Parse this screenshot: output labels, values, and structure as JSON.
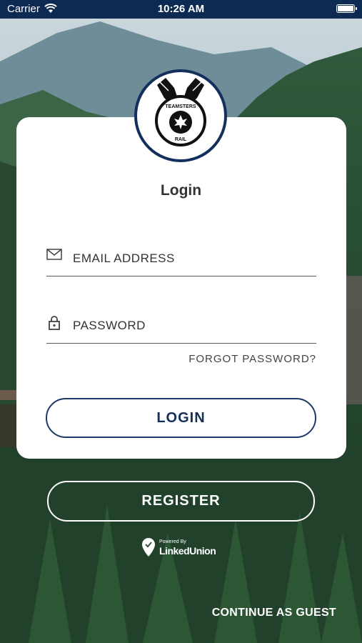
{
  "status_bar": {
    "carrier": "Carrier",
    "time": "10:26 AM"
  },
  "logo": {
    "top_text": "TEAMSTERS",
    "bottom_text": "RAIL"
  },
  "login": {
    "title": "Login",
    "email_label": "EMAIL ADDRESS",
    "password_label": "PASSWORD",
    "forgot_label": "FORGOT PASSWORD?",
    "login_button": "LOGIN"
  },
  "register_button": "REGISTER",
  "powered_by": {
    "small": "Powered By",
    "brand": "LinkedUnion"
  },
  "guest_label": "CONTINUE AS GUEST",
  "colors": {
    "navy": "#13305c",
    "status_bar": "#0d2a52",
    "card": "#ffffff"
  }
}
